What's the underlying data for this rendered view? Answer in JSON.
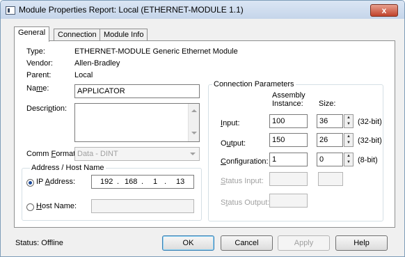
{
  "window": {
    "title": "Module Properties Report: Local (ETHERNET-MODULE 1.1)",
    "close_glyph": "x"
  },
  "tabs": [
    {
      "label": "General",
      "active": true
    },
    {
      "label": "Connection",
      "active": false
    },
    {
      "label": "Module Info",
      "active": false
    }
  ],
  "general": {
    "type_label": "Type:",
    "type_value": "ETHERNET-MODULE Generic Ethernet Module",
    "vendor_label": "Vendor:",
    "vendor_value": "Allen-Bradley",
    "parent_label": "Parent:",
    "parent_value": "Local",
    "name_label_pre": "Na",
    "name_label_u": "m",
    "name_label_post": "e:",
    "name_value": "APPLICATOR",
    "desc_label_pre": "Descri",
    "desc_label_u": "p",
    "desc_label_post": "tion:",
    "desc_value": "",
    "comm_label_pre": "Comm ",
    "comm_label_u": "F",
    "comm_label_post": "ormat:",
    "comm_value": "Data - DINT"
  },
  "address": {
    "group_title": "Address / Host Name",
    "ip_label_pre": "IP ",
    "ip_label_u": "A",
    "ip_label_post": "ddress:",
    "ip": [
      "192",
      "168",
      "1",
      "13"
    ],
    "ip_selected": true,
    "host_label_pre": "",
    "host_label_u": "H",
    "host_label_post": "ost Name:",
    "host_value": ""
  },
  "connection": {
    "group_title": "Connection Parameters",
    "col_assembly_1": "Assembly",
    "col_assembly_2": "Instance:",
    "col_size": "Size:",
    "input_label_pre": "",
    "input_label_u": "I",
    "input_label_post": "nput:",
    "input_instance": "100",
    "input_size": "36",
    "input_unit": "(32-bit)",
    "output_label_pre": "O",
    "output_label_u": "u",
    "output_label_post": "tput:",
    "output_instance": "150",
    "output_size": "26",
    "output_unit": "(32-bit)",
    "config_label_pre": "",
    "config_label_u": "C",
    "config_label_post": "onfiguration:",
    "config_instance": "1",
    "config_size": "0",
    "config_unit": "(8-bit)",
    "status_input_label_pre": "",
    "status_input_label_u": "S",
    "status_input_label_post": "tatus Input:",
    "status_output_label_pre": "S",
    "status_output_label_u": "t",
    "status_output_label_post": "atus Output:"
  },
  "footer": {
    "status": "Status:  Offline",
    "ok": "OK",
    "cancel": "Cancel",
    "apply": "Apply",
    "help": "Help"
  }
}
